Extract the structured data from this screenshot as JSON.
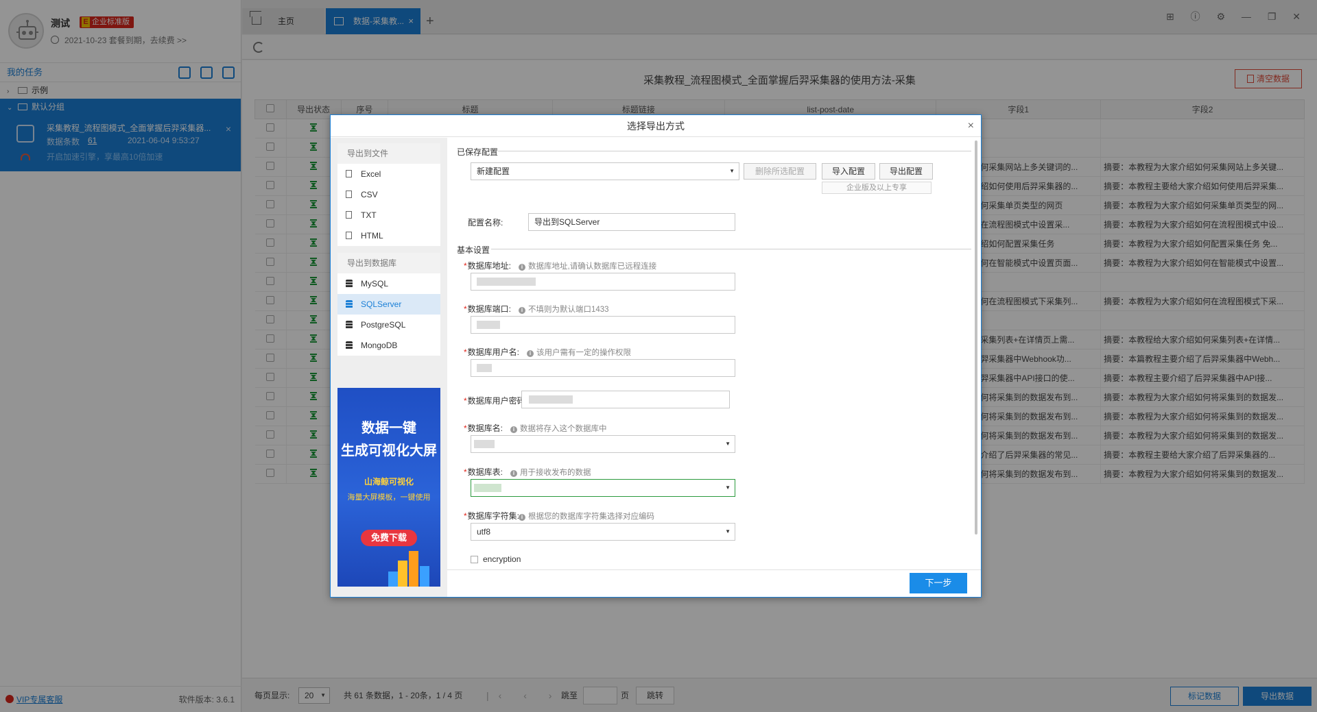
{
  "user": {
    "name": "测试",
    "edition_badge_icon": "E",
    "edition_badge": "企业标准版",
    "expiry": "2021-10-23 套餐到期，去续费 >>"
  },
  "sidebar": {
    "tasks_title": "我的任务",
    "tree": [
      {
        "label": "示例",
        "arrow": "›",
        "expanded": false
      },
      {
        "label": "默认分组",
        "arrow": "⌄",
        "expanded": true
      }
    ],
    "task": {
      "name": "采集教程_流程图模式_全面掌握后羿采集器...",
      "close": "×",
      "count_label": "数据条数",
      "count": "61",
      "date": "2021-06-04 9:53:27",
      "speed_tip": "开启加速引擎，享最高10倍加速"
    },
    "vip_link": "VIP专属客服",
    "version": "软件版本: 3.6.1"
  },
  "tabs": [
    {
      "label": "主页",
      "active": false
    },
    {
      "label": "数据-采集教...",
      "active": true,
      "close": "×"
    }
  ],
  "tab_add": "+",
  "window_controls": "⊞ ⓘ ⚙ — ❐ ✕",
  "content": {
    "title": "采集教程_流程图模式_全面掌握后羿采集器的使用方法-采集",
    "clear_button": "清空数据",
    "columns": [
      "",
      "导出状态",
      "序号",
      "标题",
      "标题链接",
      "list-post-date",
      "字段1",
      "字段2"
    ],
    "rows": [
      {
        "f1": "",
        "f2": ""
      },
      {
        "f1": "",
        "f2": ""
      },
      {
        "f1": "大家介绍如何采集网站上多关键词的...",
        "f2": "摘要：本教程为大家介绍如何采集网站上多关键..."
      },
      {
        "f1": "绍给大家介绍如何使用后羿采集器的...",
        "f2": "摘要：本教程主要给大家介绍如何使用后羿采集..."
      },
      {
        "f1": "大家介绍如何采集单页类型的网页",
        "f2": "摘要：本教程为大家介绍如何采集单页类型的网..."
      },
      {
        "f1": "家介绍如何在流程图模式中设置采...",
        "f2": "摘要：本教程为大家介绍如何在流程图模式中设..."
      },
      {
        "f1": "程为大家介绍如何配置采集任务",
        "f2": "摘要：本教程为大家介绍如何配置采集任务 免..."
      },
      {
        "f1": "大家介绍如何在智能模式中设置页面...",
        "f2": "摘要：本教程为大家介绍如何在智能模式中设置..."
      },
      {
        "f1": "",
        "f2": ""
      },
      {
        "f1": "大家介绍如何在流程图模式下采集列...",
        "f2": "摘要：本教程为大家介绍如何在流程图模式下采..."
      },
      {
        "f1": "",
        "f2": ""
      },
      {
        "f1": "家介绍如何采集列表+在详情页上需...",
        "f2": "摘要：本教程给大家介绍如何采集列表+在详情..."
      },
      {
        "f1": "要介绍了后羿采集器中Webhook功...",
        "f2": "摘要：本篇教程主要介绍了后羿采集器中Webh..."
      },
      {
        "f1": "要介绍了后羿采集器中API接口的使...",
        "f2": "摘要：本教程主要介绍了后羿采集器中API接..."
      },
      {
        "f1": "大家介绍如何将采集到的数据发布到...",
        "f2": "摘要：本教程为大家介绍如何将采集到的数据发..."
      },
      {
        "f1": "大家介绍如何将采集到的数据发布到...",
        "f2": "摘要：本教程为大家介绍如何将采集到的数据发..."
      },
      {
        "f1": "大家介绍如何将采集到的数据发布到...",
        "f2": "摘要：本教程为大家介绍如何将采集到的数据发..."
      },
      {
        "f1": "主要给大家介绍了后羿采集器的常见...",
        "f2": "摘要：本教程主要给大家介绍了后羿采集器的..."
      },
      {
        "f1": "大家介绍如何将采集到的数据发布到...",
        "f2": "摘要：本教程为大家介绍如何将采集到的数据发..."
      }
    ]
  },
  "pager": {
    "per_page_label": "每页显示:",
    "per_page": "20",
    "info": "共 61 条数据，1 - 20条，1 / 4 页",
    "nav": "|‹ ‹ › ›|",
    "jump_label": "跳至",
    "page_label": "页",
    "jump_button": "跳转",
    "mark_button": "标记数据",
    "export_button": "导出数据"
  },
  "modal": {
    "title": "选择导出方式",
    "close": "×",
    "file_group_title": "导出到文件",
    "file_items": [
      "Excel",
      "CSV",
      "TXT",
      "HTML"
    ],
    "db_group_title": "导出到数据库",
    "db_items": [
      "MySQL",
      "SQLServer",
      "PostgreSQL",
      "MongoDB"
    ],
    "active_item": "SQLServer",
    "ad": {
      "line1": "数据一键",
      "line2": "生成可视化大屏",
      "line3": "山海鲸可视化",
      "line4": "海量大屏模板，一键使用",
      "button": "免费下载"
    },
    "saved_config_title": "已保存配置",
    "config_select": "新建配置",
    "delete_config": "删除所选配置",
    "import_config": "导入配置",
    "export_config": "导出配置",
    "enterprise_note": "企业版及以上专享",
    "config_name_label": "配置名称:",
    "config_name_value": "导出到SQLServer",
    "basic_title": "基本设置",
    "fields": [
      {
        "label": "数据库地址:",
        "hint": "数据库地址,请确认数据库已远程连接"
      },
      {
        "label": "数据库端口:",
        "hint": "不填则为默认端口1433"
      },
      {
        "label": "数据库用户名:",
        "hint": "该用户需有一定的操作权限"
      },
      {
        "label": "数据库用户密码:",
        "hint": ""
      },
      {
        "label": "数据库名:",
        "hint": "数据将存入这个数据库中"
      },
      {
        "label": "数据库表:",
        "hint": "用于接收发布的数据"
      },
      {
        "label": "数据库字符集:",
        "hint": "根据您的数据库字符集选择对应编码"
      }
    ],
    "required_mark": "*",
    "info_mark": "i",
    "charset_value": "utf8",
    "encryption_label": "encryption",
    "next_button": "下一步"
  }
}
